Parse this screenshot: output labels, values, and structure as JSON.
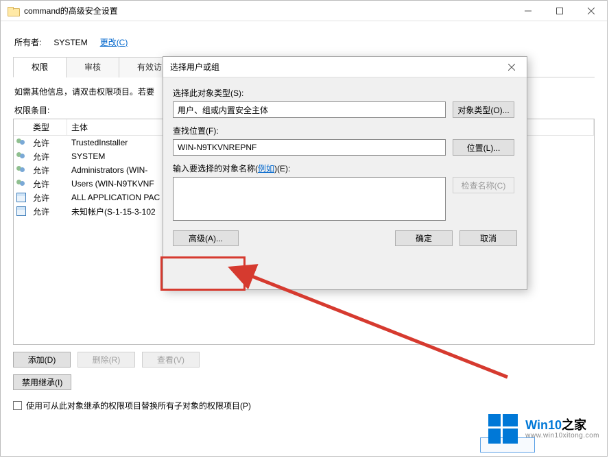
{
  "main": {
    "title": "command的高级安全设置",
    "owner_label": "所有者:",
    "owner_value": "SYSTEM",
    "change_link": "更改(C)",
    "tabs": {
      "permissions": "权限",
      "audit": "审核",
      "effective": "有效访"
    },
    "help_text": "如需其他信息，请双击权限项目。若要",
    "entries_label": "权限条目:",
    "columns": {
      "type": "类型",
      "subject": "主体"
    },
    "rows": [
      {
        "icon": "users",
        "type": "允许",
        "subject": "TrustedInstaller"
      },
      {
        "icon": "users",
        "type": "允许",
        "subject": "SYSTEM"
      },
      {
        "icon": "users",
        "type": "允许",
        "subject": "Administrators (WIN-"
      },
      {
        "icon": "users",
        "type": "允许",
        "subject": "Users (WIN-N9TKVNF"
      },
      {
        "icon": "pkg",
        "type": "允许",
        "subject": "ALL APPLICATION PAC"
      },
      {
        "icon": "pkg",
        "type": "允许",
        "subject": "未知帐户(S-1-15-3-102"
      }
    ],
    "buttons": {
      "add": "添加(D)",
      "remove": "删除(R)",
      "view": "查看(V)",
      "disable_inherit": "禁用继承(I)"
    },
    "checkbox_label": "使用可从此对象继承的权限项目替换所有子对象的权限项目(P)"
  },
  "dialog": {
    "title": "选择用户或组",
    "object_type_label": "选择此对象类型(S):",
    "object_type_value": "用户、组或内置安全主体",
    "object_type_btn": "对象类型(O)...",
    "location_label": "查找位置(F):",
    "location_value": "WIN-N9TKVNREPNF",
    "location_btn": "位置(L)...",
    "name_label_pre": "输入要选择的对象名称(",
    "name_label_link": "例如",
    "name_label_post": ")(E):",
    "name_value": "",
    "check_btn": "检查名称(C)",
    "advanced_btn": "高级(A)...",
    "ok_btn": "确定",
    "cancel_btn": "取消"
  },
  "watermark": {
    "brand_a": "Win10",
    "brand_b": "之家",
    "url": "www.win10xitong.com"
  }
}
